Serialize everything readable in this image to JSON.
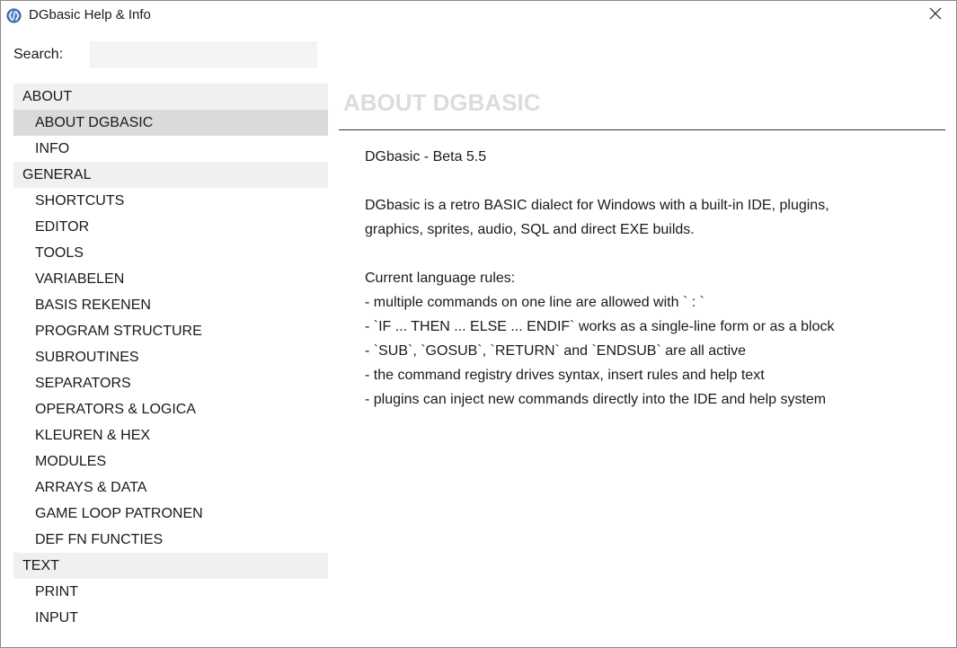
{
  "window": {
    "title": "DGbasic Help & Info",
    "close_glyph": "✕",
    "icon": "dgbasic-app-icon"
  },
  "search": {
    "label": "Search:",
    "value": "",
    "placeholder": ""
  },
  "nav": {
    "items": [
      {
        "label": "ABOUT",
        "type": "category"
      },
      {
        "label": "ABOUT DGBASIC",
        "type": "child",
        "selected": true
      },
      {
        "label": "INFO",
        "type": "child"
      },
      {
        "label": "GENERAL",
        "type": "category"
      },
      {
        "label": "SHORTCUTS",
        "type": "child"
      },
      {
        "label": "EDITOR",
        "type": "child"
      },
      {
        "label": "TOOLS",
        "type": "child"
      },
      {
        "label": "VARIABELEN",
        "type": "child"
      },
      {
        "label": "BASIS REKENEN",
        "type": "child"
      },
      {
        "label": "PROGRAM STRUCTURE",
        "type": "child"
      },
      {
        "label": "SUBROUTINES",
        "type": "child"
      },
      {
        "label": "SEPARATORS",
        "type": "child"
      },
      {
        "label": "OPERATORS & LOGICA",
        "type": "child"
      },
      {
        "label": "KLEUREN & HEX",
        "type": "child"
      },
      {
        "label": "MODULES",
        "type": "child"
      },
      {
        "label": "ARRAYS & DATA",
        "type": "child"
      },
      {
        "label": "GAME LOOP PATRONEN",
        "type": "child"
      },
      {
        "label": "DEF FN FUNCTIES",
        "type": "child"
      },
      {
        "label": "TEXT",
        "type": "category"
      },
      {
        "label": "PRINT",
        "type": "child"
      },
      {
        "label": "INPUT",
        "type": "child"
      }
    ]
  },
  "content": {
    "title": "ABOUT DGBASIC",
    "lines": [
      "DGbasic - Beta 5.5",
      "",
      "DGbasic is a retro BASIC dialect for Windows with a built-in IDE, plugins,",
      "graphics, sprites, audio, SQL and direct EXE builds.",
      "",
      "Current language rules:",
      "- multiple commands on one line are allowed with ` : `",
      "- `IF ... THEN ... ELSE ... ENDIF` works as a single-line form or as a block",
      "- `SUB`, `GOSUB`, `RETURN` and `ENDSUB` are all active",
      "- the command registry drives syntax, insert rules and help text",
      "- plugins can inject new commands directly into the IDE and help system"
    ]
  },
  "colors": {
    "category_bg": "#f0f0f0",
    "selected_bg": "#dadada",
    "title_color": "#dcdcdc",
    "search_bg": "#f4f4f4"
  }
}
